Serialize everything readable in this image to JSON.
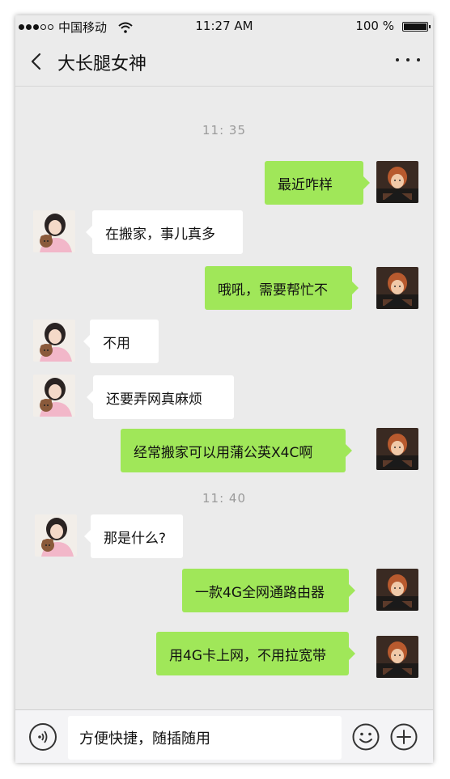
{
  "status_bar": {
    "carrier": "中国移动",
    "time": "11:27 AM",
    "battery": "100 %",
    "battery_level_pct": 100
  },
  "header": {
    "title": "大长腿女神"
  },
  "chat": {
    "timestamps": [
      "11: 35",
      "11: 40"
    ],
    "messages": [
      {
        "from": "me",
        "text": "最近咋样"
      },
      {
        "from": "them",
        "text": "在搬家，事儿真多"
      },
      {
        "from": "me",
        "text": "哦吼，需要帮忙不"
      },
      {
        "from": "them",
        "text": "不用"
      },
      {
        "from": "them",
        "text": "还要弄网真麻烦"
      },
      {
        "from": "me",
        "text": "经常搬家可以用蒲公英X4C啊"
      },
      {
        "from": "them",
        "text": "那是什么?"
      },
      {
        "from": "me",
        "text": "一款4G全网通路由器"
      },
      {
        "from": "me",
        "text": "用4G卡上网，不用拉宽带"
      }
    ]
  },
  "input_bar": {
    "text": "方便快捷，随插随用"
  },
  "icons": {
    "back": "chevron-left-icon",
    "more": "more-dots-icon",
    "voice": "voice-icon",
    "emoji": "emoji-icon",
    "plus": "plus-icon"
  },
  "colors": {
    "outgoing_bubble": "#a0e759",
    "incoming_bubble": "#ffffff",
    "chat_background": "#ebebeb"
  }
}
